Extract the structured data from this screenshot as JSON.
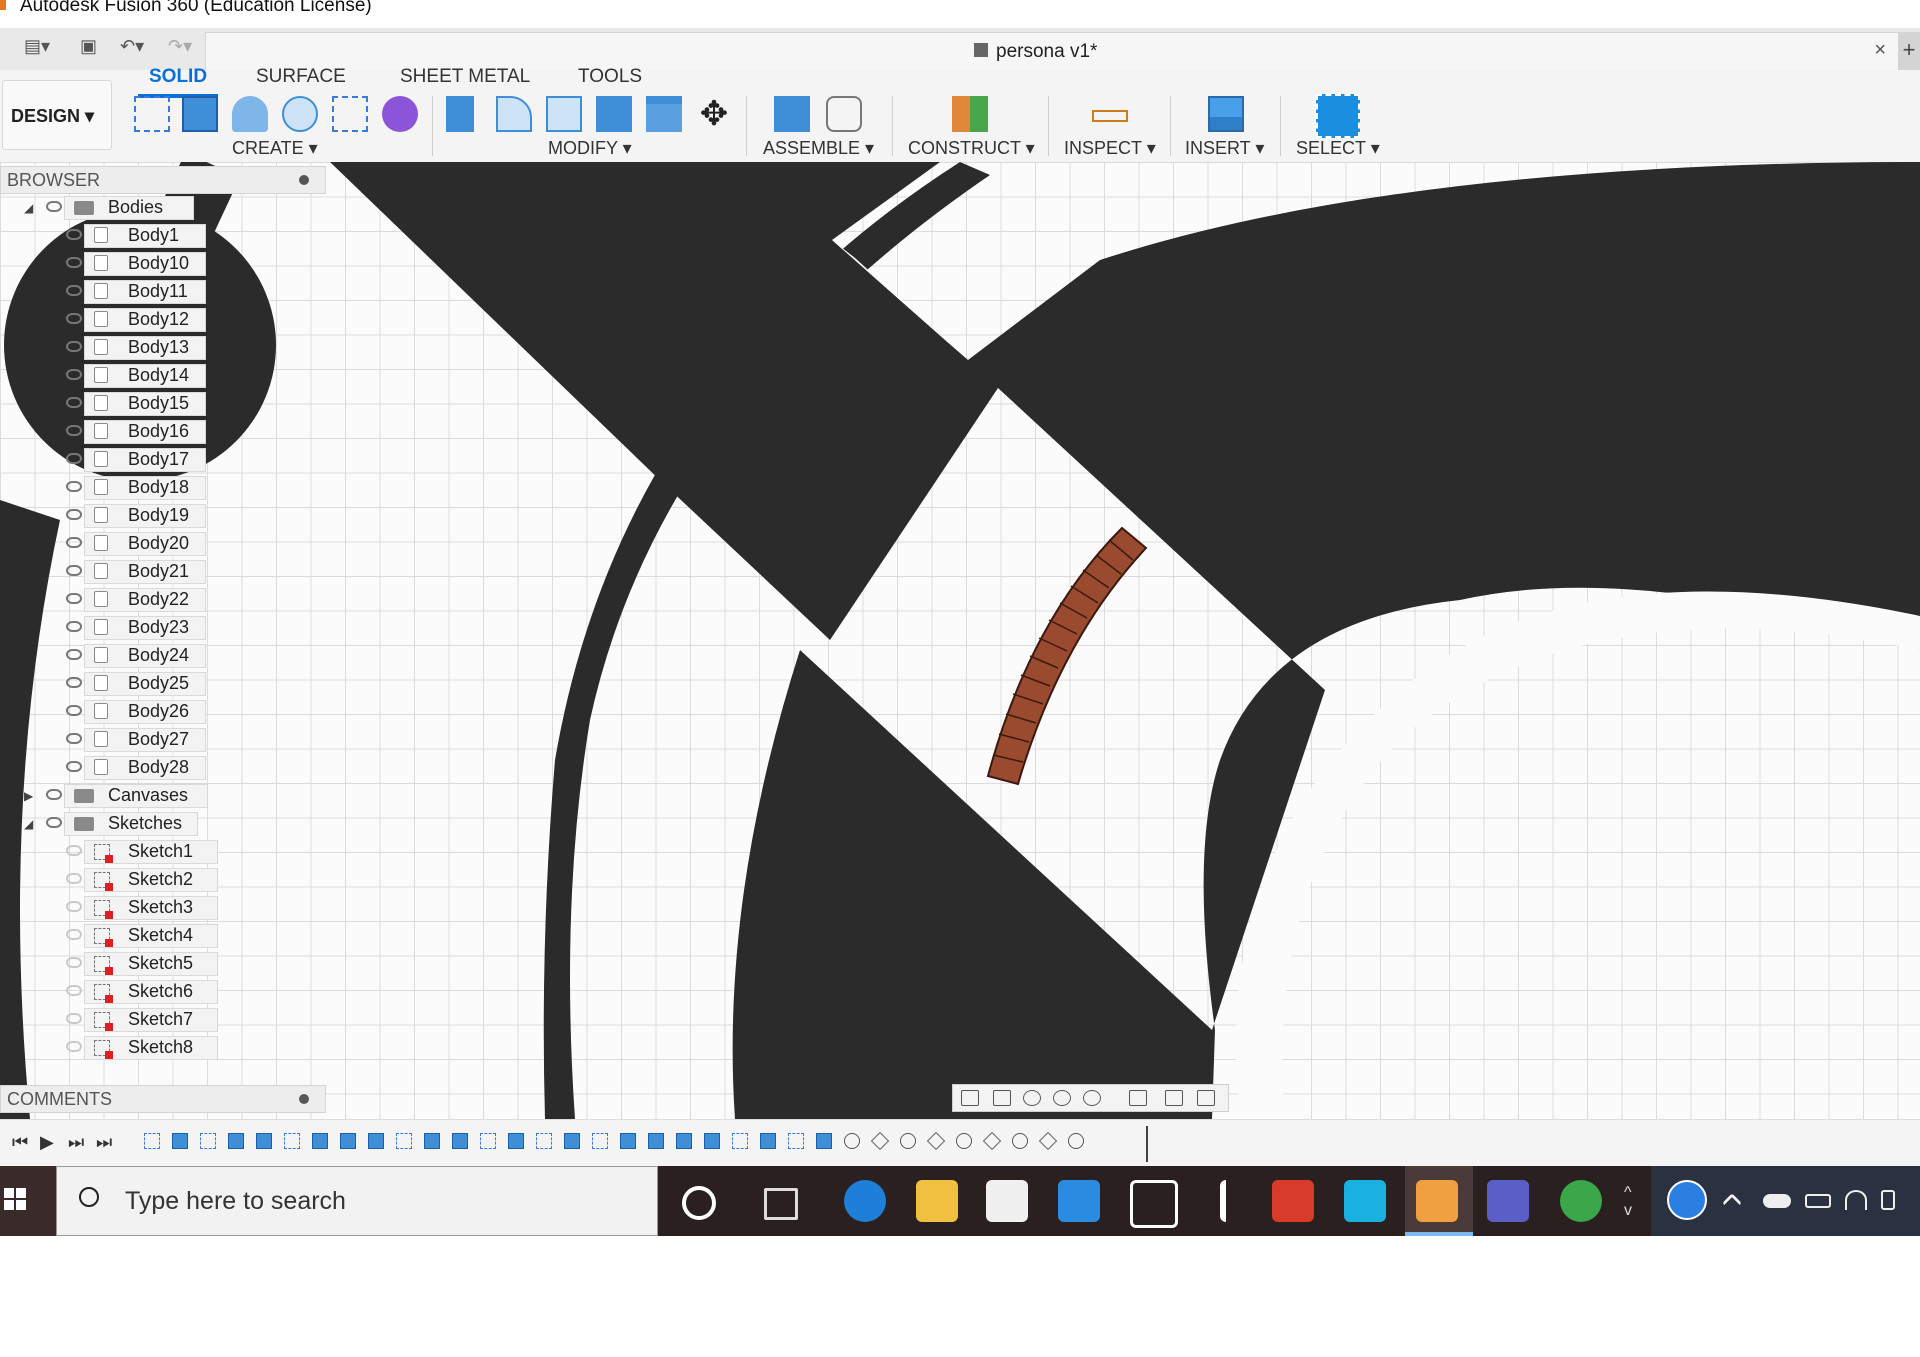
{
  "window": {
    "title": "Autodesk Fusion 360 (Education License)"
  },
  "document": {
    "tab_name": "persona v1*",
    "close_glyph": "×",
    "new_tab_glyph": "+"
  },
  "ribbon": {
    "workspace": "DESIGN ▾",
    "tabs": [
      "SOLID",
      "SURFACE",
      "SHEET METAL",
      "TOOLS"
    ],
    "active_tab": "SOLID",
    "groups": [
      "CREATE ▾",
      "MODIFY ▾",
      "ASSEMBLE ▾",
      "CONSTRUCT ▾",
      "INSPECT ▾",
      "INSERT ▾",
      "SELECT ▾"
    ],
    "accent": "#0a6fd6"
  },
  "browser": {
    "header": "BROWSER",
    "folders": {
      "bodies": "Bodies",
      "canvases": "Canvases",
      "sketches": "Sketches"
    },
    "bodies": [
      "Body1",
      "Body10",
      "Body11",
      "Body12",
      "Body13",
      "Body14",
      "Body15",
      "Body16",
      "Body17",
      "Body18",
      "Body19",
      "Body20",
      "Body21",
      "Body22",
      "Body23",
      "Body24",
      "Body25",
      "Body26",
      "Body27",
      "Body28"
    ],
    "sketches": [
      "Sketch1",
      "Sketch2",
      "Sketch3",
      "Sketch4",
      "Sketch5",
      "Sketch6",
      "Sketch7",
      "Sketch8"
    ]
  },
  "comments": {
    "header": "COMMENTS"
  },
  "timeline": {
    "controls": [
      "⏮",
      "▶",
      "⏭",
      "⏭"
    ],
    "features": [
      "sk",
      "ex",
      "sk",
      "ex",
      "ex",
      "sk",
      "ex",
      "ex",
      "ex",
      "sk",
      "ex",
      "ex",
      "sk",
      "ex",
      "sk",
      "ex",
      "sk",
      "ex",
      "ex",
      "ex",
      "ex",
      "sk",
      "ex",
      "sk",
      "ex",
      "jn",
      "mv",
      "jn",
      "mv",
      "jn",
      "mv",
      "jn",
      "mv",
      "jn"
    ]
  },
  "taskbar": {
    "search_placeholder": "Type here to search",
    "apps": [
      "cortana-icon",
      "task-view-icon",
      "edge-icon",
      "file-explorer-icon",
      "store-icon",
      "mail-icon",
      "dropbox-icon",
      "app-bolt-icon",
      "office-icon",
      "app-c-icon",
      "fusion360-icon",
      "teams-icon",
      "app-green-icon"
    ]
  },
  "colors": {
    "body_dark": "#2b2b2b",
    "body_brown": "#9a4a2e",
    "grid": "#dcdcdc"
  }
}
